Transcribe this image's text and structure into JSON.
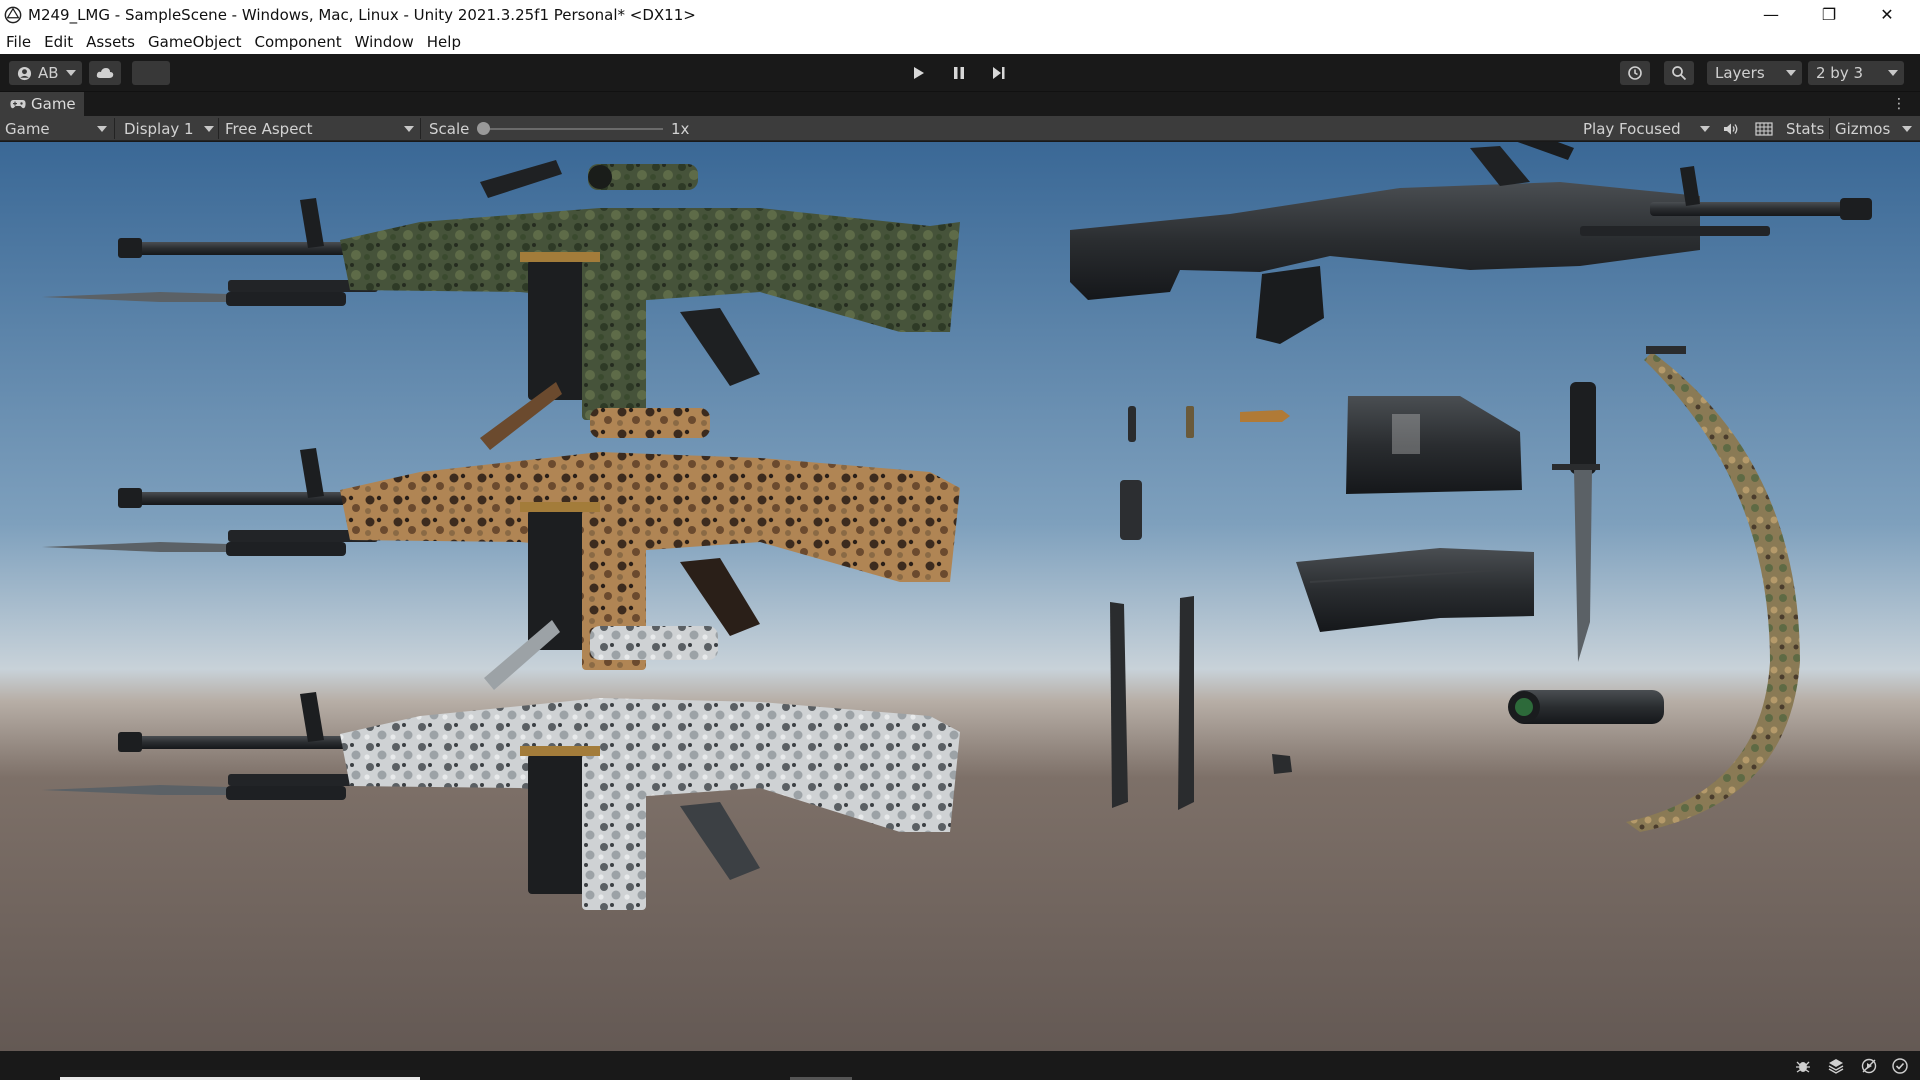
{
  "window": {
    "title": "M249_LMG - SampleScene - Windows, Mac, Linux - Unity 2021.3.25f1 Personal* <DX11>",
    "minimize": "—",
    "maximize": "❐",
    "close": "✕"
  },
  "menu": [
    "File",
    "Edit",
    "Assets",
    "GameObject",
    "Component",
    "Window",
    "Help"
  ],
  "toolbar": {
    "account_label": "AB",
    "layers_label": "Layers",
    "layout_label": "2 by 3"
  },
  "game_tab": {
    "label": "Game"
  },
  "game_view": {
    "view_select": "Game",
    "display_select": "Display 1",
    "aspect_select": "Free Aspect",
    "scale_label": "Scale",
    "scale_value": "1x",
    "play_mode_select": "Play Focused",
    "stats_label": "Stats",
    "gizmos_label": "Gizmos"
  },
  "scene": {
    "weapons": [
      "woodland-camo-lmg",
      "desert-camo-lmg",
      "snow-camo-lmg",
      "black-lmg"
    ],
    "colors": {
      "sky_top": "#3f6f9c",
      "sky_horizon": "#c9d3da",
      "ground": "#6a5e56",
      "woodland": "#4a5a3a",
      "desert": "#a0774a",
      "snow": "#cfd2d4",
      "gunmetal": "#2a2c2e"
    }
  }
}
